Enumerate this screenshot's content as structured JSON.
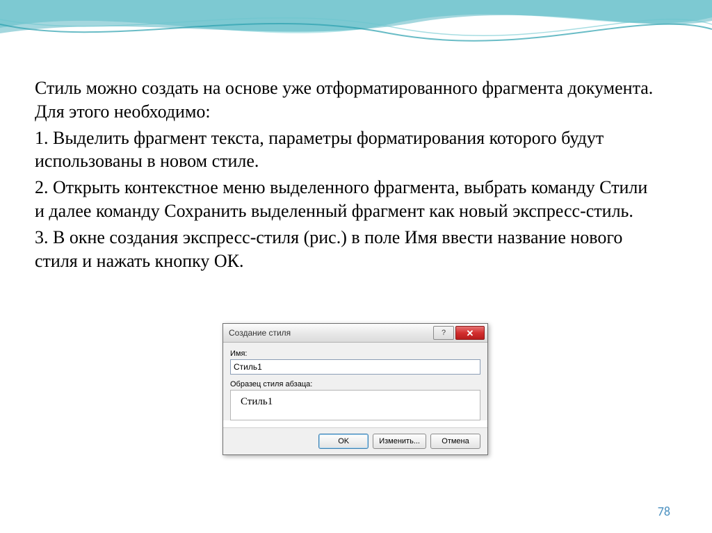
{
  "slide": {
    "paragraphs": [
      "Стиль можно создать на основе уже отформатированного фрагмента документа. Для этого необходимо:",
      "1. Выделить фрагмент текста, параметры форматирования которого будут использованы в новом стиле.",
      "2. Открыть контекстное меню выделенного фрагмента, выбрать команду Стили и далее команду Сохранить выделенный фрагмент как новый экспресс-стиль.",
      "3. В окне создания экспресс-стиля (рис.) в поле Имя ввести название нового стиля и нажать кнопку ОК."
    ],
    "page_number": "78"
  },
  "dialog": {
    "title": "Создание стиля",
    "help_glyph": "?",
    "close_glyph": "✕",
    "name_label": "Имя:",
    "name_value": "Стиль1",
    "preview_label": "Образец стиля абзаца:",
    "preview_text": "Стиль1",
    "buttons": {
      "ok": "OK",
      "modify": "Изменить...",
      "cancel": "Отмена"
    }
  }
}
